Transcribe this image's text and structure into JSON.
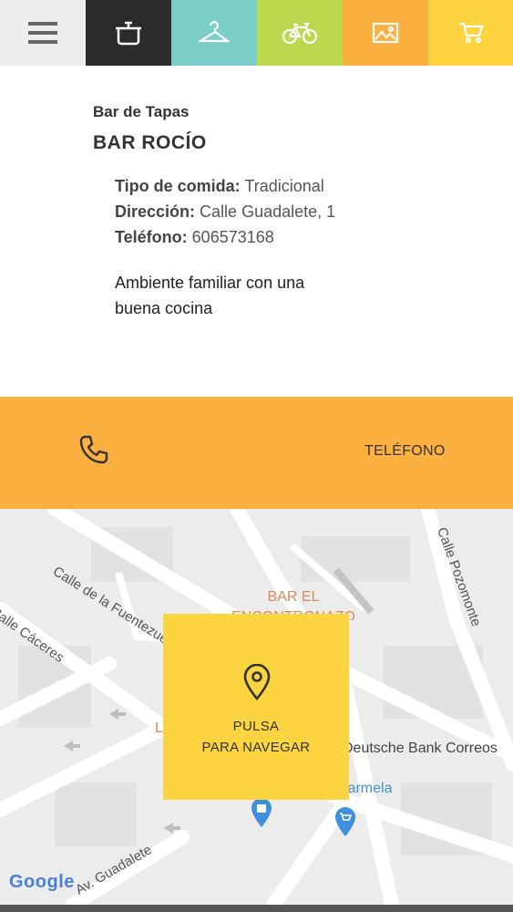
{
  "nav": {
    "items": [
      {
        "icon": "menu-icon",
        "bg": "#eeeeee"
      },
      {
        "icon": "cooking-pot-icon",
        "bg": "#2b2b2b"
      },
      {
        "icon": "hanger-icon",
        "bg": "#7ccfc9"
      },
      {
        "icon": "bicycle-icon",
        "bg": "#bcd84e"
      },
      {
        "icon": "image-icon",
        "bg": "#fbb03f"
      },
      {
        "icon": "cart-icon",
        "bg": "#fbd440"
      }
    ]
  },
  "place": {
    "category": "Bar de Tapas",
    "name": "BAR ROCÍO",
    "food_type_label": "Tipo de comida:",
    "food_type": "Tradicional",
    "address_label": "Dirección:",
    "address": "Calle Guadalete, 1",
    "phone_label": "Teléfono:",
    "phone": "606573168",
    "description": "Ambiente familiar con una buena cocina"
  },
  "call": {
    "icon": "phone-icon",
    "label": "TELÉFONO"
  },
  "map": {
    "streets": {
      "fuentezuela": "Calle de la Fuentezuela",
      "caceres": "Calle Cáceres",
      "pozomonte": "Calle Pozomonte",
      "guadalete": "Av. Guadalete"
    },
    "poi_bar": "BAR EL ENCONTRONAZO",
    "poi_bank": "Deutsche Bank Correos",
    "poi_carmela": "Carmela",
    "poi_l": "L",
    "google": "Google",
    "navigate_line1": "PULSA",
    "navigate_line2": "PARA NAVEGAR",
    "accent_text": "#d98a5a",
    "poi_blue": "#3f8fdc"
  }
}
